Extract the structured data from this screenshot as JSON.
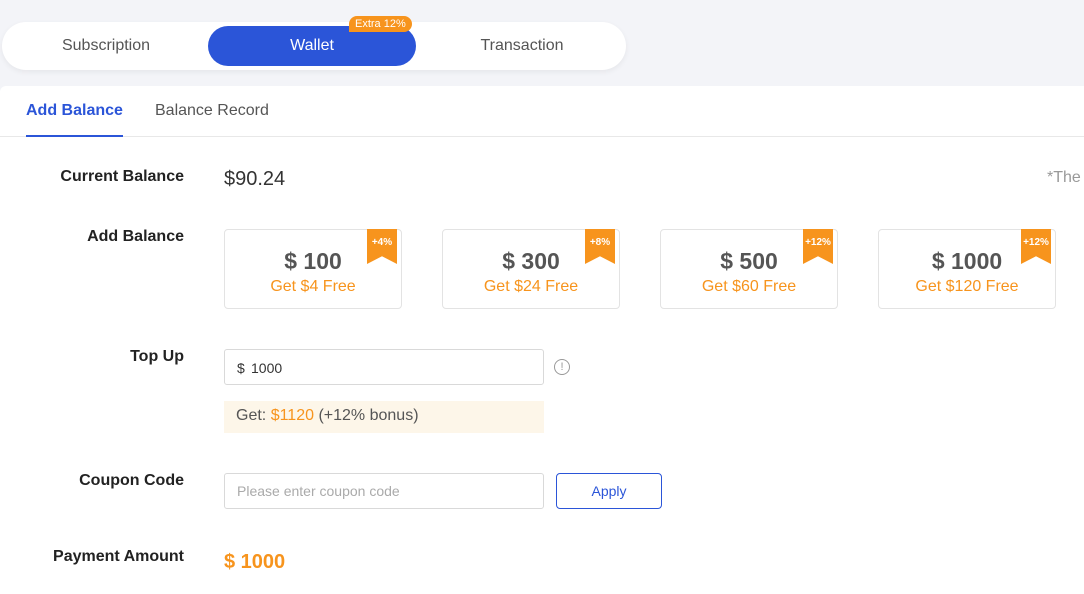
{
  "top_tabs": [
    {
      "label": "Subscription"
    },
    {
      "label": "Wallet"
    },
    {
      "label": "Transaction"
    }
  ],
  "wallet_badge": "Extra 12%",
  "sub_tabs": [
    {
      "label": "Add Balance"
    },
    {
      "label": "Balance Record"
    }
  ],
  "current_balance": {
    "label": "Current Balance",
    "value": "$90.24",
    "note": "*The"
  },
  "add_balance": {
    "label": "Add Balance",
    "options": [
      {
        "amount": "$ 100",
        "bonus_text": "Get $4 Free",
        "ribbon": "+4%"
      },
      {
        "amount": "$ 300",
        "bonus_text": "Get $24 Free",
        "ribbon": "+8%"
      },
      {
        "amount": "$ 500",
        "bonus_text": "Get $60 Free",
        "ribbon": "+12%"
      },
      {
        "amount": "$ 1000",
        "bonus_text": "Get $120 Free",
        "ribbon": "+12%"
      }
    ]
  },
  "top_up": {
    "label": "Top Up",
    "currency": "$",
    "value": "1000",
    "info_icon": "info-icon",
    "bonus_prefix": "Get:",
    "bonus_amount": "$1120",
    "bonus_suffix": "(+12% bonus)"
  },
  "coupon": {
    "label": "Coupon Code",
    "placeholder": "Please enter coupon code",
    "value": "",
    "apply_label": "Apply"
  },
  "payment": {
    "label": "Payment Amount",
    "value": "$ 1000"
  },
  "colors": {
    "accent": "#2b55d8",
    "orange": "#f7941d",
    "bonus_bg": "#fdf6e9"
  }
}
